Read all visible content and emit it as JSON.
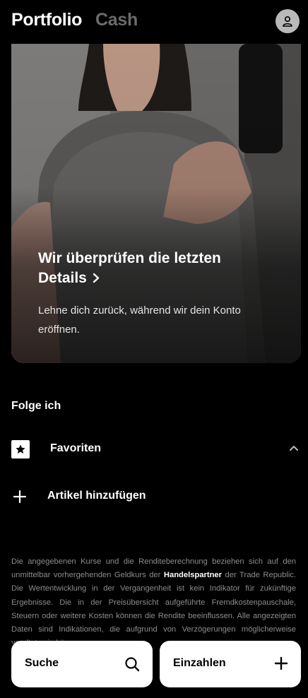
{
  "header": {
    "tabs": [
      {
        "label": "Portfolio",
        "active": true
      },
      {
        "label": "Cash",
        "active": false
      }
    ],
    "avatar_icon": "user-icon"
  },
  "hero": {
    "title": "Wir überprüfen die letzten Details",
    "subtitle": "Lehne dich zurück, während wir dein Konto eröffnen."
  },
  "follow": {
    "title": "Folge ich",
    "favorites_label": "Favoriten",
    "add_label": "Artikel hinzufügen"
  },
  "disclaimer": {
    "part1": "Die angegebenen Kurse und die Renditeberechnung beziehen sich auf den unmittelbar vorhergehenden Geldkurs der",
    "partner": "Handelspartner",
    "part2": "der Trade Republic. Die Wertentwicklung in der Vergangenheit ist kein Indikator für zukünftige Ergebnisse. Die in der Preisübersicht aufgeführte Fremdkostenpauschale, Steuern oder weitere Kosten können die Rendite beeinflussen. Alle angezeigten Daten sind Indikationen, die aufgrund von Verzögerungen möglicherweise veraltet sein können."
  },
  "bottom_bar": {
    "search_label": "Suche",
    "deposit_label": "Einzahlen"
  },
  "colors": {
    "background": "#000000",
    "inactive_tab": "#6b6b6b",
    "button_bg": "#ffffff"
  }
}
